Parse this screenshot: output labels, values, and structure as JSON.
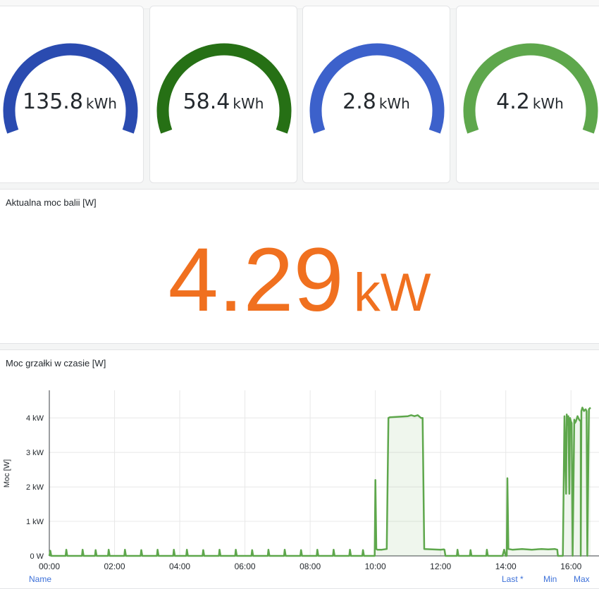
{
  "gauges": [
    {
      "value": "135.8",
      "unit": "kWh",
      "color": "#2a4bb0"
    },
    {
      "value": "58.4",
      "unit": "kWh",
      "color": "#267015"
    },
    {
      "value": "2.8",
      "unit": "kWh",
      "color": "#3c61cb"
    },
    {
      "value": "4.2",
      "unit": "kWh",
      "color": "#5ea74c"
    }
  ],
  "stat_panel": {
    "title": "Aktualna moc balii [W]",
    "value": "4.29",
    "unit": "kW",
    "color": "#f0701f"
  },
  "chart_panel": {
    "title": "Moc grzałki w czasie [W]"
  },
  "legend": {
    "name": "Name",
    "last": "Last *",
    "min": "Min",
    "max": "Max"
  },
  "chart_data": {
    "type": "line",
    "ylabel": "Moc [W]",
    "xlabel": "",
    "y_tick_labels": [
      "0 W",
      "1 kW",
      "2 kW",
      "3 kW",
      "4 kW"
    ],
    "y_ticks": [
      0,
      1000,
      2000,
      3000,
      4000
    ],
    "x_tick_labels": [
      "00:00",
      "02:00",
      "04:00",
      "06:00",
      "08:00",
      "10:00",
      "12:00",
      "14:00",
      "16:00"
    ],
    "x_ticks": [
      0,
      2,
      4,
      6,
      8,
      10,
      12,
      14,
      16
    ],
    "xlim": [
      0,
      16.6
    ],
    "ylim": [
      0,
      4800
    ],
    "grid": true,
    "line_color": "#5ea74c",
    "series": [
      {
        "x_unit": "hours",
        "x": [
          0,
          0.03,
          0.06,
          0.5,
          0.52,
          0.55,
          1.0,
          1.02,
          1.05,
          1.4,
          1.42,
          1.45,
          1.8,
          1.82,
          1.85,
          2.3,
          2.32,
          2.35,
          2.8,
          2.82,
          2.85,
          3.3,
          3.32,
          3.35,
          3.8,
          3.82,
          3.85,
          4.2,
          4.22,
          4.25,
          4.7,
          4.72,
          4.75,
          5.2,
          5.22,
          5.25,
          5.7,
          5.72,
          5.75,
          6.2,
          6.22,
          6.25,
          6.7,
          6.72,
          6.75,
          7.2,
          7.22,
          7.25,
          7.7,
          7.72,
          7.75,
          8.2,
          8.22,
          8.25,
          8.7,
          8.72,
          8.75,
          9.2,
          9.22,
          9.25,
          9.6,
          9.62,
          9.65,
          9.98,
          10.0,
          10.03,
          10.06,
          10.1,
          10.2,
          10.35,
          10.4,
          10.45,
          11.0,
          11.1,
          11.2,
          11.3,
          11.4,
          11.45,
          11.5,
          12.0,
          12.1,
          12.12,
          12.15,
          12.5,
          12.52,
          12.55,
          12.9,
          12.92,
          12.95,
          13.4,
          13.42,
          13.45,
          13.9,
          13.95,
          14.0,
          14.03,
          14.05,
          14.08,
          14.2,
          14.5,
          14.8,
          15.1,
          15.3,
          15.5,
          15.58,
          15.6,
          15.75,
          15.8,
          15.85,
          15.87,
          15.9,
          15.92,
          15.95,
          15.97,
          16.0,
          16.02,
          16.05,
          16.1,
          16.12,
          16.15,
          16.2,
          16.25,
          16.3,
          16.3,
          16.32,
          16.35,
          16.4,
          16.45,
          16.48,
          16.5,
          16.55,
          16.6
        ],
        "y": [
          0,
          150,
          0,
          0,
          180,
          0,
          0,
          180,
          0,
          0,
          170,
          0,
          0,
          180,
          0,
          0,
          180,
          0,
          0,
          170,
          0,
          0,
          180,
          0,
          0,
          180,
          0,
          0,
          180,
          0,
          0,
          170,
          0,
          0,
          180,
          0,
          0,
          180,
          0,
          0,
          170,
          0,
          0,
          180,
          0,
          0,
          180,
          0,
          0,
          170,
          0,
          0,
          180,
          0,
          0,
          180,
          0,
          0,
          180,
          0,
          0,
          170,
          0,
          0,
          2200,
          200,
          180,
          180,
          180,
          200,
          4000,
          4020,
          4050,
          4080,
          4050,
          4080,
          4000,
          4000,
          200,
          180,
          190,
          180,
          0,
          0,
          180,
          0,
          0,
          170,
          0,
          0,
          180,
          0,
          0,
          180,
          0,
          0,
          2250,
          200,
          180,
          200,
          180,
          200,
          190,
          200,
          180,
          0,
          0,
          4050,
          1800,
          4100,
          3800,
          4050,
          1800,
          4000,
          3900,
          3850,
          0,
          3950,
          3850,
          3900,
          4050,
          3950,
          3900,
          0,
          4200,
          4300,
          4200,
          4250,
          4200,
          0,
          4250,
          4300
        ]
      }
    ]
  }
}
